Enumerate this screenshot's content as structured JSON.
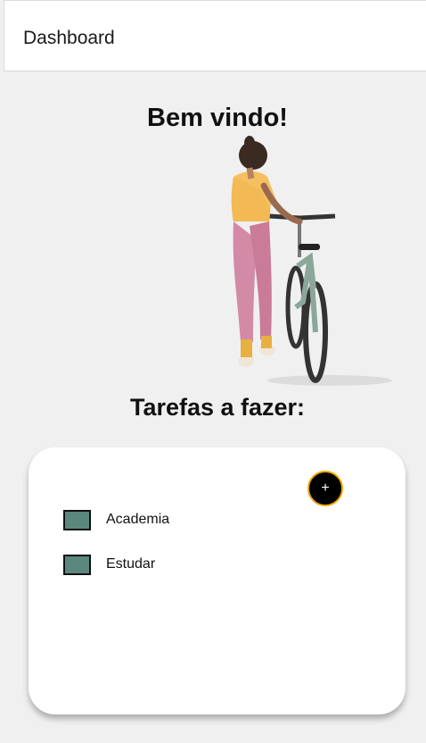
{
  "header": {
    "title": "Dashboard"
  },
  "main": {
    "welcome": "Bem vindo!",
    "tasks_heading": "Tarefas a fazer:"
  },
  "tasks_card": {
    "add_label": "+",
    "items": [
      {
        "label": "Academia",
        "color": "#5b877d"
      },
      {
        "label": "Estudar",
        "color": "#5b877d"
      }
    ]
  },
  "colors": {
    "task_color": "#5b877d",
    "add_button_border": "#f0a800",
    "background": "#f0f0f0"
  },
  "icons": {
    "illustration": "woman-with-bicycle-illustration"
  }
}
